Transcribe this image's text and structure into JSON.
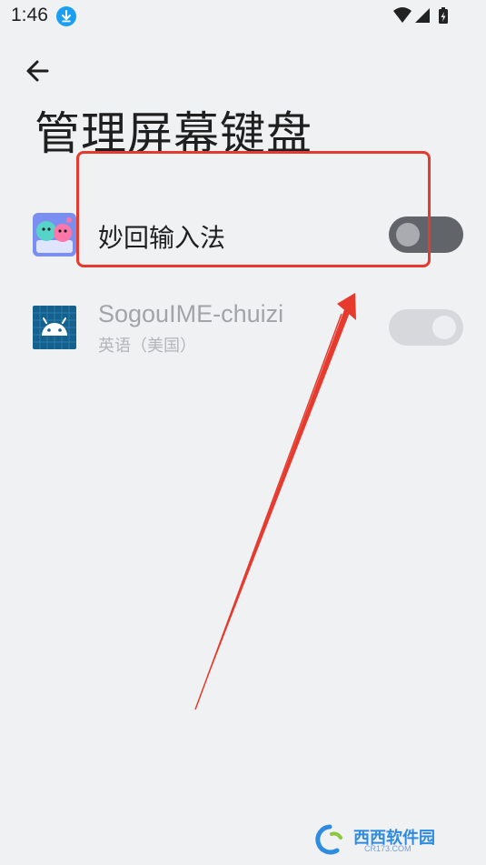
{
  "status_bar": {
    "time": "1:46",
    "icons": [
      "download-icon",
      "wifi-icon",
      "signal-icon",
      "battery-charging-icon"
    ]
  },
  "header": {
    "back_icon": "back-arrow-icon",
    "title": "管理屏幕键盘"
  },
  "keyboards": [
    {
      "name": "妙回输入法",
      "subtitle": "",
      "icon": "miaohui-app-icon",
      "enabled": false,
      "highlighted": true
    },
    {
      "name": "SogouIME-chuizi",
      "subtitle": "英语（美国）",
      "icon": "android-app-icon",
      "enabled": true,
      "disabled": true
    }
  ],
  "annotation": {
    "color": "#e53a2d"
  },
  "watermark": {
    "text": "西西软件园",
    "sub": "CR173.COM"
  }
}
